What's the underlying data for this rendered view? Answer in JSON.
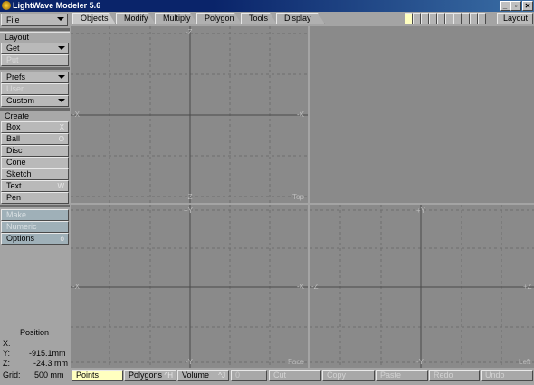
{
  "window": {
    "title": "LightWave Modeler 5.6",
    "min_label": "_",
    "max_label": "▫",
    "close_label": "✕"
  },
  "sidebar": {
    "file": "File",
    "layout_header": "Layout",
    "get": "Get",
    "put": "Put",
    "prefs": "Prefs",
    "user": "User",
    "custom": "Custom",
    "create_header": "Create",
    "create_items": [
      {
        "label": "Box",
        "key": "X"
      },
      {
        "label": "Ball",
        "key": "O"
      },
      {
        "label": "Disc",
        "key": ""
      },
      {
        "label": "Cone",
        "key": ""
      },
      {
        "label": "Sketch",
        "key": ""
      },
      {
        "label": "Text",
        "key": "W"
      },
      {
        "label": "Pen",
        "key": ""
      }
    ],
    "make": "Make",
    "numeric": "Numeric",
    "options": "Options",
    "options_key": "o"
  },
  "tabs": [
    "Objects",
    "Modify",
    "Multiply",
    "Polygon",
    "Tools",
    "Display"
  ],
  "layout_button": "Layout",
  "viewports": {
    "top": {
      "label": "Top",
      "up": "-Z",
      "down": "-Z",
      "left": "-X",
      "right": "-X"
    },
    "face": {
      "label": "Face",
      "up": "+Y",
      "down": "-Y",
      "left": "-X",
      "right": "-X"
    },
    "left": {
      "label": "Left",
      "up": "+Y",
      "down": "-Y",
      "left": "-Z",
      "right": "+Z"
    }
  },
  "position": {
    "title": "Position",
    "x_label": "X:",
    "x_value": "",
    "y_label": "Y:",
    "y_value": "-915.1mm",
    "z_label": "Z:",
    "z_value": "-24.3 mm"
  },
  "statusbar": {
    "grid_label": "Grid:",
    "grid_value": "500 mm",
    "points": "Points",
    "polygons": "Polygons",
    "polygons_key": "^H",
    "volume": "Volume",
    "volume_key": "^J",
    "count": "0",
    "cut": "Cut",
    "copy": "Copy",
    "paste": "Paste",
    "redo": "Redo",
    "undo": "Undo"
  },
  "colors": {
    "points_active": "#ffffc0",
    "viewport_bg": "#8a8a8a",
    "title_bar": "#0a246a"
  }
}
